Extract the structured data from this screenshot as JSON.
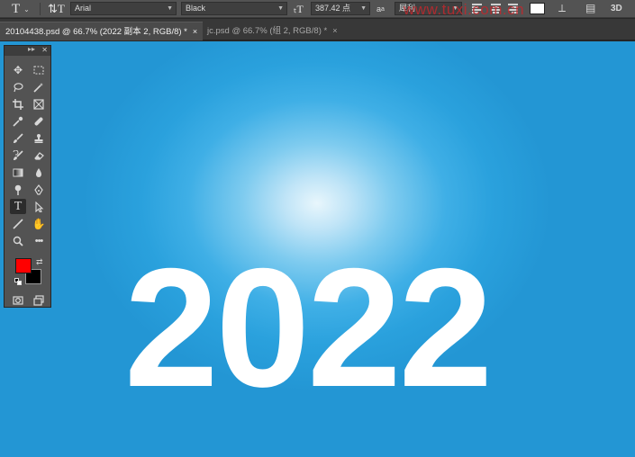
{
  "options_bar": {
    "font_family": "Arial",
    "font_style": "Black",
    "font_size": "387.42 点",
    "anti_alias_label": "a",
    "anti_alias_value": "犀利",
    "watermark_text": "www.tuxi.com.cn",
    "text_color": "#ffffff",
    "mode_3d": "3D"
  },
  "tabs": [
    {
      "label": "20104438.psd @ 66.7% (2022 副本 2, RGB/8) *",
      "close": "×"
    },
    {
      "label": "jc.psd @ 66.7% (组 2, RGB/8) *",
      "close": "×"
    }
  ],
  "canvas": {
    "text": "2022",
    "text_color": "#ffffff",
    "background_color": "#2a9fdc"
  },
  "tools_panel": {
    "foreground_color": "#ff0000",
    "background_color": "#000000",
    "selected_tool": "type-tool"
  }
}
